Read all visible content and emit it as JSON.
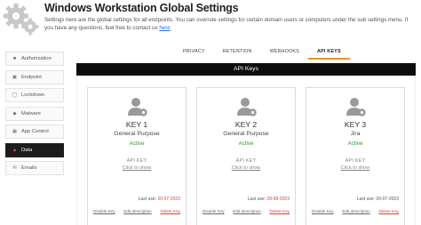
{
  "header": {
    "title": "Windows Workstation Global Settings",
    "description": "Settings here are the global settings for all endpoints. You can overrule settings for certain domain users or computers under the sub settings menu. If you have any questions, feel free to contact us",
    "link_text": "here"
  },
  "sidebar": {
    "items": [
      {
        "label": "Authorization",
        "icon": "lock-icon"
      },
      {
        "label": "Endpoint",
        "icon": "computer-icon"
      },
      {
        "label": "Lockdown",
        "icon": "lockdown-icon"
      },
      {
        "label": "Malware",
        "icon": "bug-icon"
      },
      {
        "label": "App Control",
        "icon": "app-icon"
      },
      {
        "label": "Data",
        "icon": "data-icon",
        "active": true
      },
      {
        "label": "Emails",
        "icon": "mail-icon"
      }
    ]
  },
  "tabs": [
    {
      "label": "PRIVACY"
    },
    {
      "label": "RETENTION"
    },
    {
      "label": "WEBHOOKS"
    },
    {
      "label": "API KEYS",
      "active": true
    }
  ],
  "api_bar": {
    "title": "API Keys"
  },
  "cards": [
    {
      "name": "KEY 1",
      "purpose": "General Purpose",
      "status": "Active",
      "api_label": "API KEY",
      "click_show": "Click to show",
      "last_use_label": "Last use:",
      "last_use_date": "20-07-2023",
      "disable": "Disable Key",
      "edit": "Edit description",
      "delete": "Delete Key"
    },
    {
      "name": "KEY 2",
      "purpose": "General Purpose",
      "status": "Active",
      "api_label": "API KEY",
      "click_show": "Click to show",
      "last_use_label": "Last use:",
      "last_use_date": "28-08-2023",
      "disable": "Disable Key",
      "edit": "Edit description",
      "delete": "Delete Key"
    },
    {
      "name": "KEY 3",
      "purpose": "Jira",
      "status": "Active",
      "api_label": "API KEY",
      "click_show": "Click to show",
      "last_use_label": "Last use:",
      "last_use_date": "26-07-2023",
      "disable": "Disable Key",
      "edit": "Edit description",
      "delete": "Delete Key"
    }
  ],
  "colors": {
    "accent_tab": "#e8922a",
    "status_active": "#2e9c3b",
    "delete_red": "#d94033",
    "dark_bar": "#0d0d0d"
  }
}
